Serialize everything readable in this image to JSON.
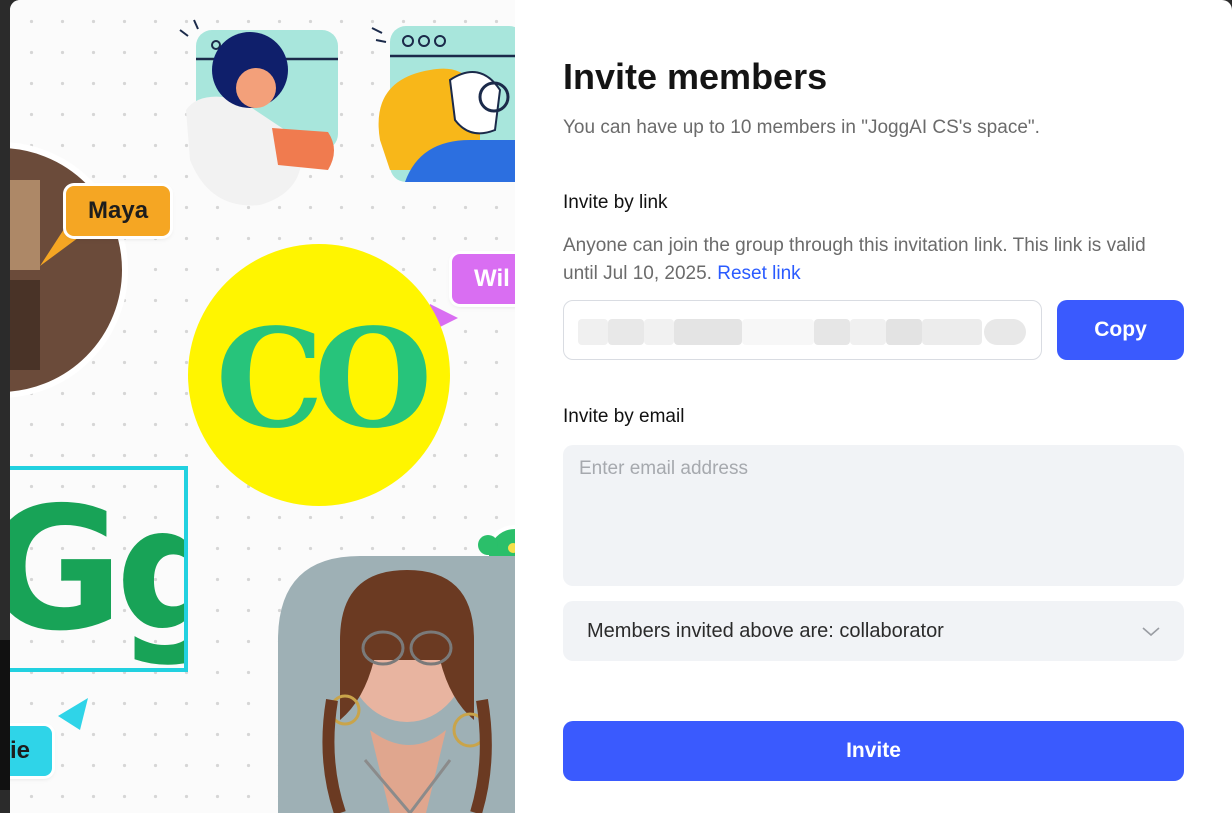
{
  "modal": {
    "title": "Invite members",
    "subtitle": "You can have up to 10 members in \"JoggAI CS's space\"."
  },
  "invite_by_link": {
    "label": "Invite by link",
    "description": "Anyone can join the group through this invitation link. This link is valid until Jul 10, 2025.",
    "reset_link_label": "Reset link",
    "copy_button_label": "Copy"
  },
  "invite_by_email": {
    "label": "Invite by email",
    "placeholder": "Enter email address",
    "role_select_value": "Members invited above are: collaborator",
    "invite_button_label": "Invite"
  },
  "illustration": {
    "tags": [
      "Maya",
      "Wil",
      "ie"
    ],
    "big_letters": "CO",
    "box_letters": "Gg"
  },
  "colors": {
    "primary": "#3a5afe",
    "link": "#2a5bff",
    "input_bg": "#f1f3f6",
    "tag_maya": "#f5a623",
    "tag_wil": "#d96ef2",
    "tag_ie": "#2fd4e8",
    "circle_yellow": "#fff500",
    "letters_green": "#27c47b"
  },
  "icons": [
    "chevron-down-icon"
  ]
}
